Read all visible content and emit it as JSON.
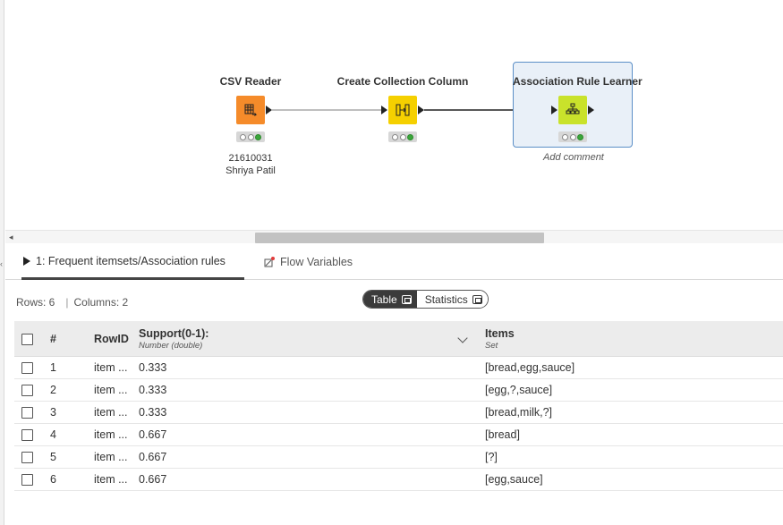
{
  "workflow": {
    "nodes": [
      {
        "title": "CSV Reader",
        "color": "#f58b2a",
        "icon": "csv-reader-icon",
        "labels": [
          "21610031",
          "Shriya Patil"
        ]
      },
      {
        "title": "Create Collection Column",
        "color": "#f5d000",
        "icon": "collection-icon"
      },
      {
        "title": "Association Rule Learner",
        "color": "#c9e22b",
        "icon": "association-rule-icon",
        "comment": "Add comment"
      }
    ]
  },
  "tabs": [
    {
      "label": "1: Frequent itemsets/Association rules",
      "icon": "play-icon"
    },
    {
      "label": "Flow Variables",
      "icon": "flow-variables-icon"
    }
  ],
  "info": {
    "rows": "Rows: 6",
    "sep": "|",
    "columns": "Columns: 2"
  },
  "view_toggle": {
    "table": "Table",
    "statistics": "Statistics",
    "selected": "Table"
  },
  "table": {
    "columns": [
      {
        "name": "#",
        "type": ""
      },
      {
        "name": "RowID",
        "type": ""
      },
      {
        "name": "Support(0-1):",
        "type": "Number (double)"
      },
      {
        "name": "Items",
        "type": "Set"
      }
    ],
    "rows": [
      {
        "index": "1",
        "rowid": "item ...",
        "support": "0.333",
        "items": "[bread,egg,sauce]"
      },
      {
        "index": "2",
        "rowid": "item ...",
        "support": "0.333",
        "items": "[egg,?,sauce]"
      },
      {
        "index": "3",
        "rowid": "item ...",
        "support": "0.333",
        "items": "[bread,milk,?]"
      },
      {
        "index": "4",
        "rowid": "item ...",
        "support": "0.667",
        "items": "[bread]"
      },
      {
        "index": "5",
        "rowid": "item ...",
        "support": "0.667",
        "items": "[?]"
      },
      {
        "index": "6",
        "rowid": "item ...",
        "support": "0.667",
        "items": "[egg,sauce]"
      }
    ]
  }
}
